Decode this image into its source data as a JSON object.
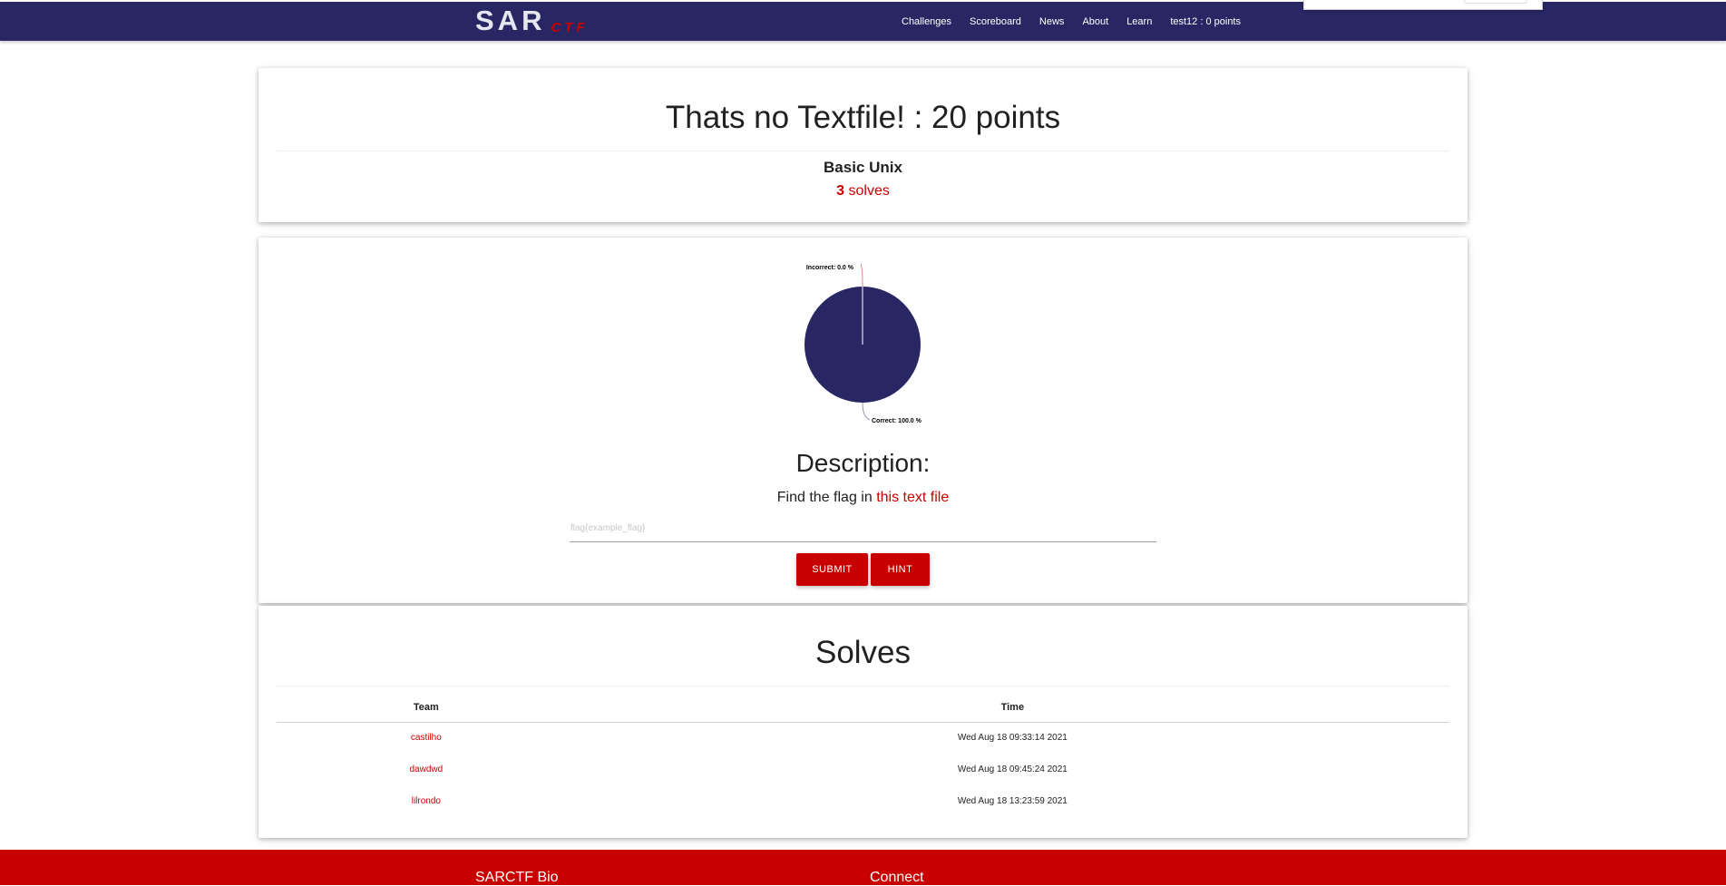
{
  "nav": {
    "logo_main": "SAR",
    "logo_sub": "CTF",
    "links": [
      "Challenges",
      "Scoreboard",
      "News",
      "About",
      "Learn",
      "test12 : 0 points"
    ]
  },
  "challenge": {
    "title": "Thats no Textfile! : 20 points",
    "category": "Basic Unix",
    "solve_count": "3",
    "solves_label": "solves"
  },
  "chart_data": {
    "type": "pie",
    "slices": [
      {
        "label": "Correct",
        "value": 100.0,
        "color": "#282764"
      },
      {
        "label": "Incorrect",
        "value": 0.0,
        "color": "#c80000"
      }
    ],
    "labels": [
      "Incorrect: 0.0 %",
      "Correct: 100.0 %"
    ]
  },
  "description": {
    "heading": "Description:",
    "text_before": "Find the flag in ",
    "link_text": "this text file"
  },
  "form": {
    "placeholder": "flag{example_flag}",
    "submit_label": "SUBMIT",
    "hint_label": "HINT"
  },
  "solves_table": {
    "title": "Solves",
    "headers": [
      "Team",
      "Time"
    ],
    "rows": [
      {
        "team": "castilho",
        "time": "Wed Aug 18 09:33:14 2021"
      },
      {
        "team": "dawdwd",
        "time": "Wed Aug 18 09:45:24 2021"
      },
      {
        "team": "lilrondo",
        "time": "Wed Aug 18 13:23:59 2021"
      }
    ]
  },
  "footer": {
    "bio_heading": "SARCTF Bio",
    "connect_heading": "Connect"
  },
  "colors": {
    "brand_navy": "#282764",
    "brand_red": "#c80000"
  }
}
